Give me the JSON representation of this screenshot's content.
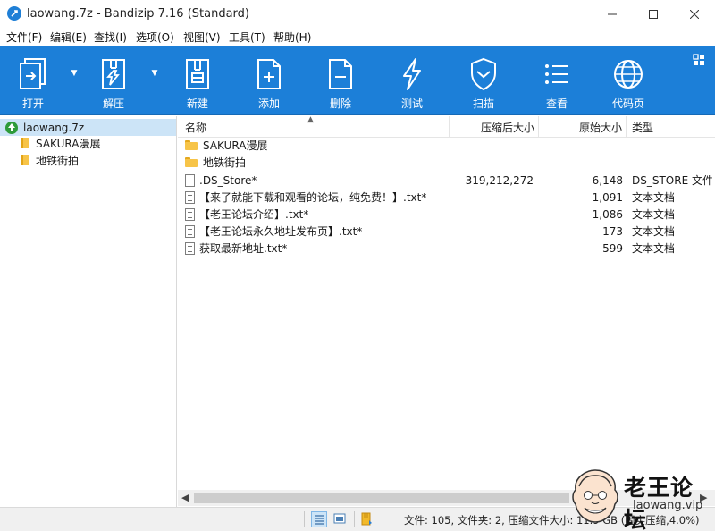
{
  "window": {
    "title": "laowang.7z - Bandizip 7.16 (Standard)"
  },
  "menu": [
    "文件(F)",
    "编辑(E)",
    "查找(I)",
    "选项(O)",
    "视图(V)",
    "工具(T)",
    "帮助(H)"
  ],
  "toolbar": {
    "buttons": [
      {
        "label": "打开",
        "icon": "open-icon"
      },
      {
        "label": "解压",
        "icon": "extract-icon"
      },
      {
        "label": "新建",
        "icon": "new-archive-icon"
      },
      {
        "label": "添加",
        "icon": "add-file-icon"
      },
      {
        "label": "删除",
        "icon": "delete-file-icon"
      },
      {
        "label": "测试",
        "icon": "test-lightning-icon"
      },
      {
        "label": "扫描",
        "icon": "scan-shield-icon"
      },
      {
        "label": "查看",
        "icon": "view-list-icon"
      },
      {
        "label": "代码页",
        "icon": "codepage-globe-icon"
      }
    ],
    "accent": "#1c7fd8"
  },
  "tree": {
    "root": "laowang.7z",
    "children": [
      "SAKURA漫展",
      "地铁街拍"
    ]
  },
  "table": {
    "columns": [
      "名称",
      "压缩后大小",
      "原始大小",
      "类型"
    ],
    "rows": [
      {
        "name": "SAKURA漫展",
        "kind": "folder",
        "compressed": "",
        "original": "",
        "type": ""
      },
      {
        "name": "地铁街拍",
        "kind": "folder",
        "compressed": "",
        "original": "",
        "type": ""
      },
      {
        "name": ".DS_Store*",
        "kind": "file",
        "compressed": "319,212,272",
        "original": "6,148",
        "type": "DS_STORE 文件"
      },
      {
        "name": "【来了就能下载和观看的论坛，纯免费！】.txt*",
        "kind": "txt",
        "compressed": "",
        "original": "1,091",
        "type": "文本文档"
      },
      {
        "name": "【老王论坛介绍】.txt*",
        "kind": "txt",
        "compressed": "",
        "original": "1,086",
        "type": "文本文档"
      },
      {
        "name": "【老王论坛永久地址发布页】.txt*",
        "kind": "txt",
        "compressed": "",
        "original": "173",
        "type": "文本文档"
      },
      {
        "name": "获取最新地址.txt*",
        "kind": "txt",
        "compressed": "",
        "original": "599",
        "type": "文本文档"
      }
    ]
  },
  "status": {
    "text": "文件: 105, 文件夹: 2, 压缩文件大小: 11.9 GB (固实压缩,4.0%)"
  },
  "watermark": {
    "title": "老王论坛",
    "url": "laowang.vip"
  }
}
